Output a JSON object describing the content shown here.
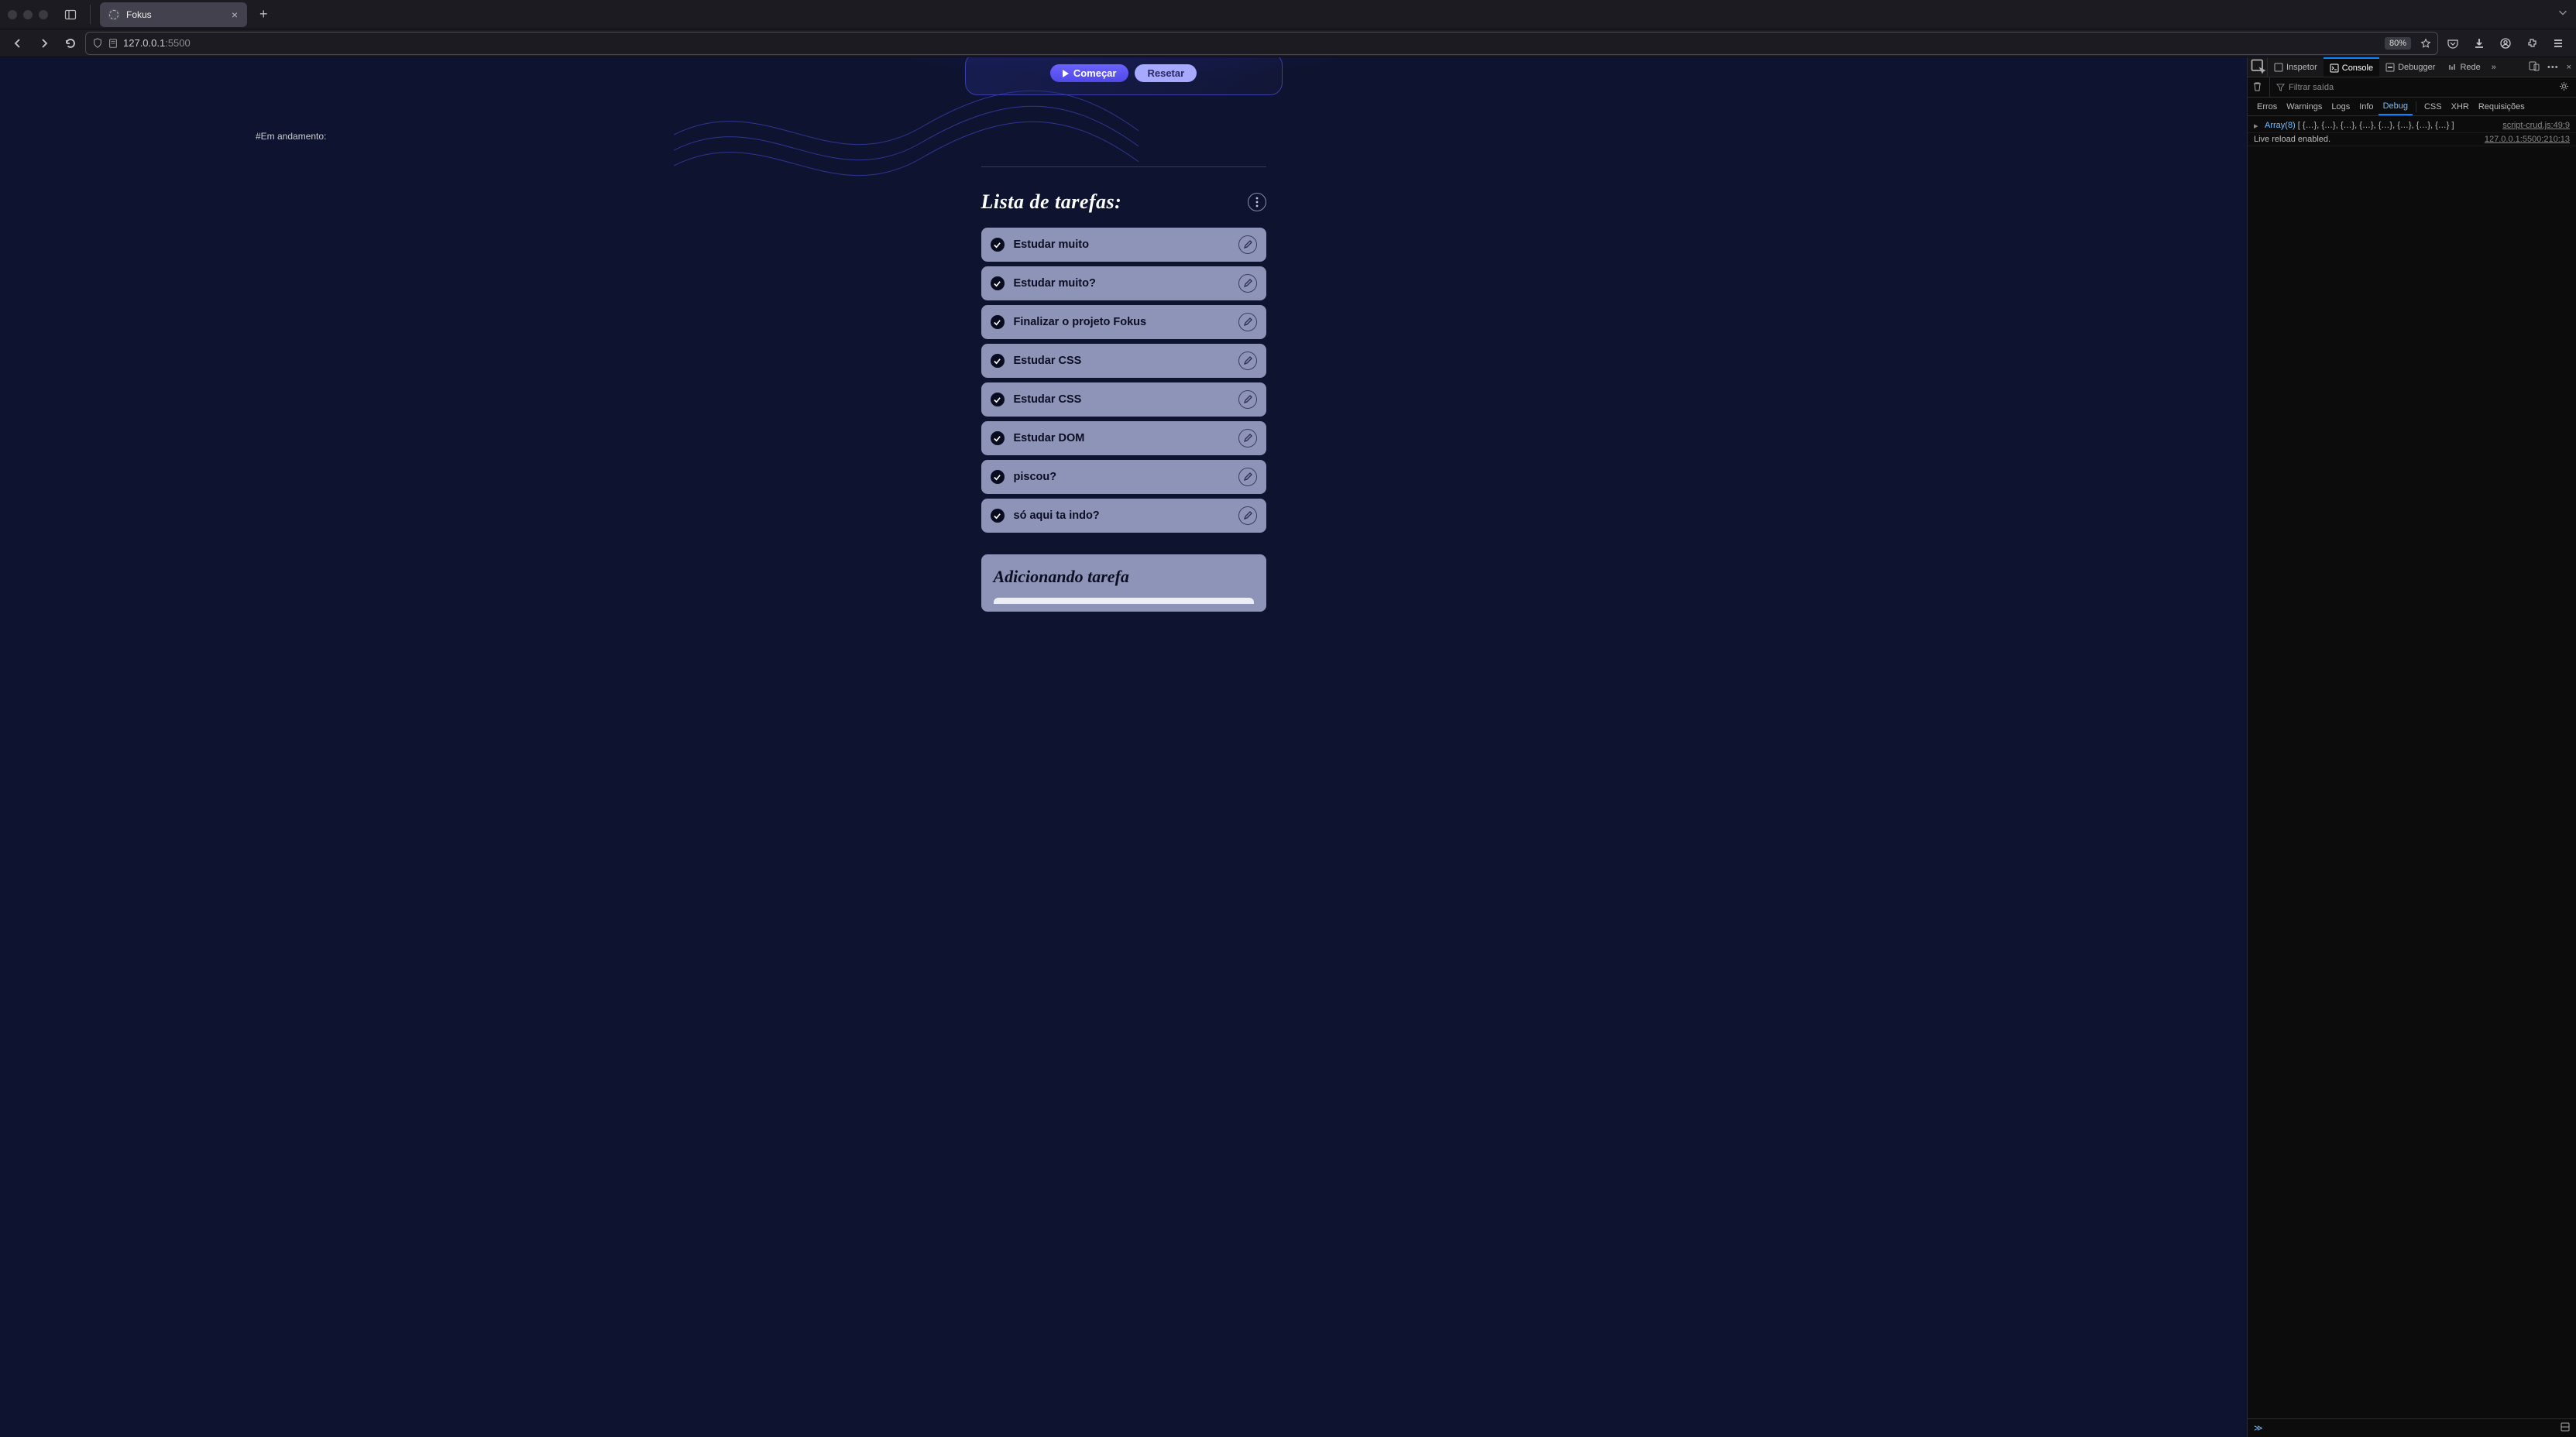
{
  "browser": {
    "tab_title": "Fokus",
    "url_host": "127.0.0.1",
    "url_port": ":5500",
    "zoom": "80%"
  },
  "app": {
    "start_label": "Começar",
    "reset_label": "Resetar",
    "status_label": "#Em andamento:",
    "tasks_heading": "Lista de tarefas:",
    "tasks": [
      {
        "text": "Estudar muito"
      },
      {
        "text": "Estudar muito?"
      },
      {
        "text": "Finalizar o projeto Fokus"
      },
      {
        "text": "Estudar CSS"
      },
      {
        "text": "Estudar CSS"
      },
      {
        "text": "Estudar DOM"
      },
      {
        "text": "piscou?"
      },
      {
        "text": "só aqui ta indo?"
      }
    ],
    "add_heading": "Adicionando tarefa"
  },
  "devtools": {
    "tabs": {
      "inspector": "Inspetor",
      "console": "Console",
      "debugger": "Debugger",
      "network": "Rede"
    },
    "filter_placeholder": "Filtrar saída",
    "categories": [
      "Erros",
      "Warnings",
      "Logs",
      "Info",
      "Debug",
      "CSS",
      "XHR",
      "Requisições"
    ],
    "active_category": "Debug",
    "log_array_label": "Array(8)",
    "log_array_body": "[ {…}, {…}, {…}, {…}, {…}, {…}, {…}, {…} ]",
    "log_source_1": "script-crud.js:49:9",
    "log_msg": "Live reload enabled.",
    "log_source_2": "127.0.0.1:5500:210:13"
  }
}
